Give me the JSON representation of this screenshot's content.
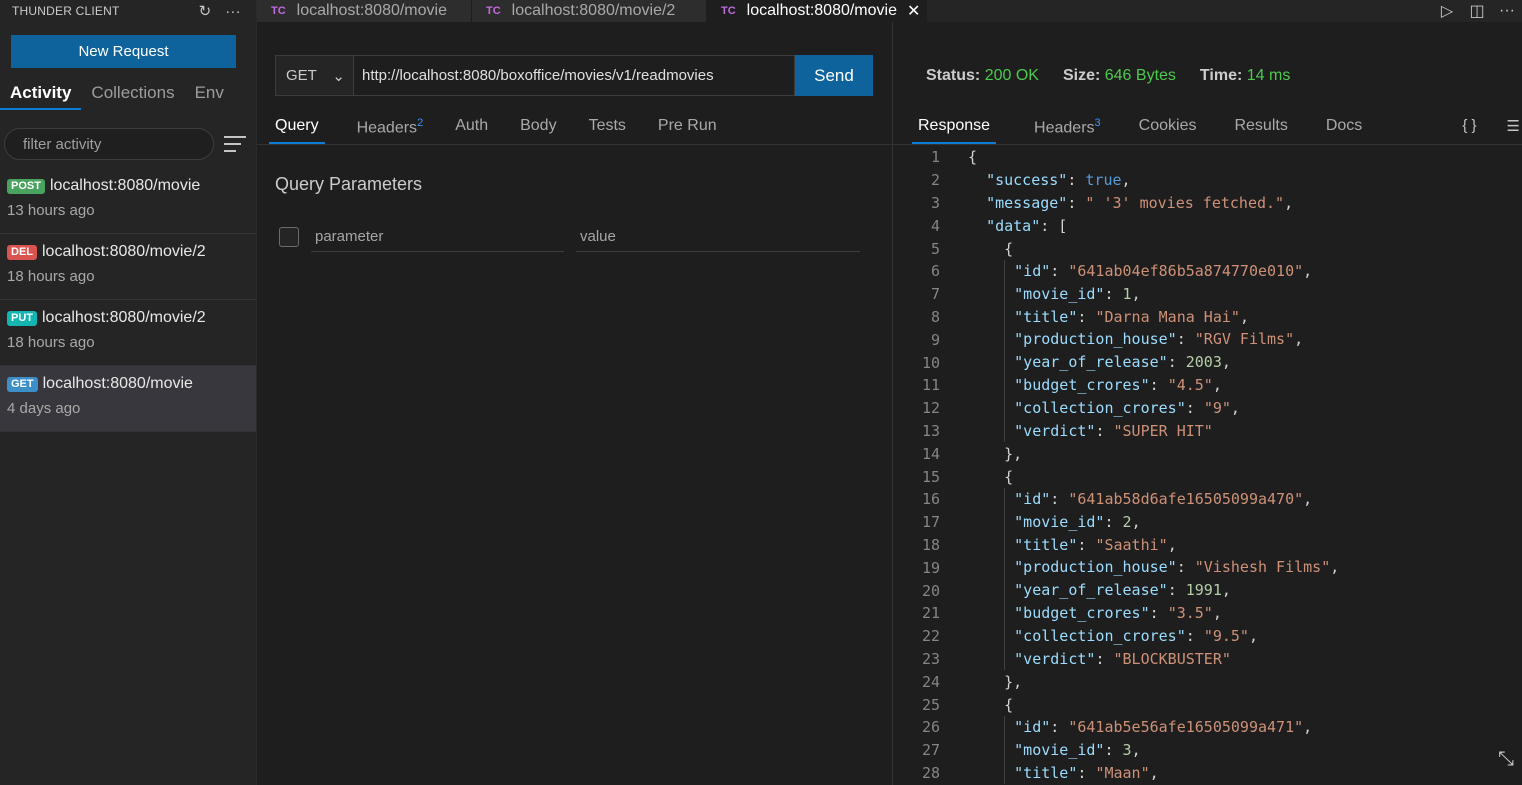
{
  "sidebar": {
    "title": "THUNDER CLIENT",
    "new_request_label": "New Request",
    "tabs": [
      {
        "label": "Activity"
      },
      {
        "label": "Collections"
      },
      {
        "label": "Env"
      }
    ],
    "filter_placeholder": "filter activity",
    "activity": [
      {
        "method": "POST",
        "url": "localhost:8080/movie",
        "time": "13 hours ago"
      },
      {
        "method": "DEL",
        "url": "localhost:8080/movie/2",
        "time": "18 hours ago"
      },
      {
        "method": "PUT",
        "url": "localhost:8080/movie/2",
        "time": "18 hours ago"
      },
      {
        "method": "GET",
        "url": "localhost:8080/movie",
        "time": "4 days ago"
      }
    ]
  },
  "tabs": [
    {
      "badge": "TC",
      "label": "localhost:8080/movie"
    },
    {
      "badge": "TC",
      "label": "localhost:8080/movie/2"
    },
    {
      "badge": "TC",
      "label": "localhost:8080/movie"
    }
  ],
  "request": {
    "method": "GET",
    "url": "http://localhost:8080/boxoffice/movies/v1/readmovies",
    "send_label": "Send",
    "tabs": [
      {
        "label": "Query",
        "count": ""
      },
      {
        "label": "Headers",
        "count": "2"
      },
      {
        "label": "Auth",
        "count": ""
      },
      {
        "label": "Body",
        "count": ""
      },
      {
        "label": "Tests",
        "count": ""
      },
      {
        "label": "Pre Run",
        "count": ""
      }
    ],
    "query_title": "Query Parameters",
    "param_placeholder": "parameter",
    "value_placeholder": "value"
  },
  "response": {
    "status_label": "Status:",
    "status_value": "200 OK",
    "size_label": "Size:",
    "size_value": "646 Bytes",
    "time_label": "Time:",
    "time_value": "14 ms",
    "tabs": [
      {
        "label": "Response",
        "count": ""
      },
      {
        "label": "Headers",
        "count": "3"
      },
      {
        "label": "Cookies",
        "count": ""
      },
      {
        "label": "Results",
        "count": ""
      },
      {
        "label": "Docs",
        "count": ""
      }
    ],
    "braces_label": "{ }",
    "lines": [
      {
        "n": "1",
        "indent": 0,
        "parts": [
          [
            "p",
            "{"
          ]
        ]
      },
      {
        "n": "2",
        "indent": 1,
        "parts": [
          [
            "k",
            "\"success\""
          ],
          [
            "p",
            ": "
          ],
          [
            "b",
            "true"
          ],
          [
            "p",
            ","
          ]
        ]
      },
      {
        "n": "3",
        "indent": 1,
        "parts": [
          [
            "k",
            "\"message\""
          ],
          [
            "p",
            ": "
          ],
          [
            "s",
            "\" '3' movies fetched.\""
          ],
          [
            "p",
            ","
          ]
        ]
      },
      {
        "n": "4",
        "indent": 1,
        "parts": [
          [
            "k",
            "\"data\""
          ],
          [
            "p",
            ": ["
          ]
        ]
      },
      {
        "n": "5",
        "indent": 2,
        "parts": [
          [
            "p",
            "{"
          ]
        ]
      },
      {
        "n": "6",
        "indent": 3,
        "parts": [
          [
            "k",
            "\"id\""
          ],
          [
            "p",
            ": "
          ],
          [
            "s",
            "\"641ab04ef86b5a874770e010\""
          ],
          [
            "p",
            ","
          ]
        ]
      },
      {
        "n": "7",
        "indent": 3,
        "parts": [
          [
            "k",
            "\"movie_id\""
          ],
          [
            "p",
            ": "
          ],
          [
            "n",
            "1"
          ],
          [
            "p",
            ","
          ]
        ]
      },
      {
        "n": "8",
        "indent": 3,
        "parts": [
          [
            "k",
            "\"title\""
          ],
          [
            "p",
            ": "
          ],
          [
            "s",
            "\"Darna Mana Hai\""
          ],
          [
            "p",
            ","
          ]
        ]
      },
      {
        "n": "9",
        "indent": 3,
        "parts": [
          [
            "k",
            "\"production_house\""
          ],
          [
            "p",
            ": "
          ],
          [
            "s",
            "\"RGV Films\""
          ],
          [
            "p",
            ","
          ]
        ]
      },
      {
        "n": "10",
        "indent": 3,
        "parts": [
          [
            "k",
            "\"year_of_release\""
          ],
          [
            "p",
            ": "
          ],
          [
            "n",
            "2003"
          ],
          [
            "p",
            ","
          ]
        ]
      },
      {
        "n": "11",
        "indent": 3,
        "parts": [
          [
            "k",
            "\"budget_crores\""
          ],
          [
            "p",
            ": "
          ],
          [
            "s",
            "\"4.5\""
          ],
          [
            "p",
            ","
          ]
        ]
      },
      {
        "n": "12",
        "indent": 3,
        "parts": [
          [
            "k",
            "\"collection_crores\""
          ],
          [
            "p",
            ": "
          ],
          [
            "s",
            "\"9\""
          ],
          [
            "p",
            ","
          ]
        ]
      },
      {
        "n": "13",
        "indent": 3,
        "parts": [
          [
            "k",
            "\"verdict\""
          ],
          [
            "p",
            ": "
          ],
          [
            "s",
            "\"SUPER HIT\""
          ]
        ]
      },
      {
        "n": "14",
        "indent": 2,
        "parts": [
          [
            "p",
            "},"
          ]
        ]
      },
      {
        "n": "15",
        "indent": 2,
        "parts": [
          [
            "p",
            "{"
          ]
        ]
      },
      {
        "n": "16",
        "indent": 3,
        "parts": [
          [
            "k",
            "\"id\""
          ],
          [
            "p",
            ": "
          ],
          [
            "s",
            "\"641ab58d6afe16505099a470\""
          ],
          [
            "p",
            ","
          ]
        ]
      },
      {
        "n": "17",
        "indent": 3,
        "parts": [
          [
            "k",
            "\"movie_id\""
          ],
          [
            "p",
            ": "
          ],
          [
            "n",
            "2"
          ],
          [
            "p",
            ","
          ]
        ]
      },
      {
        "n": "18",
        "indent": 3,
        "parts": [
          [
            "k",
            "\"title\""
          ],
          [
            "p",
            ": "
          ],
          [
            "s",
            "\"Saathi\""
          ],
          [
            "p",
            ","
          ]
        ]
      },
      {
        "n": "19",
        "indent": 3,
        "parts": [
          [
            "k",
            "\"production_house\""
          ],
          [
            "p",
            ": "
          ],
          [
            "s",
            "\"Vishesh Films\""
          ],
          [
            "p",
            ","
          ]
        ]
      },
      {
        "n": "20",
        "indent": 3,
        "parts": [
          [
            "k",
            "\"year_of_release\""
          ],
          [
            "p",
            ": "
          ],
          [
            "n",
            "1991"
          ],
          [
            "p",
            ","
          ]
        ]
      },
      {
        "n": "21",
        "indent": 3,
        "parts": [
          [
            "k",
            "\"budget_crores\""
          ],
          [
            "p",
            ": "
          ],
          [
            "s",
            "\"3.5\""
          ],
          [
            "p",
            ","
          ]
        ]
      },
      {
        "n": "22",
        "indent": 3,
        "parts": [
          [
            "k",
            "\"collection_crores\""
          ],
          [
            "p",
            ": "
          ],
          [
            "s",
            "\"9.5\""
          ],
          [
            "p",
            ","
          ]
        ]
      },
      {
        "n": "23",
        "indent": 3,
        "parts": [
          [
            "k",
            "\"verdict\""
          ],
          [
            "p",
            ": "
          ],
          [
            "s",
            "\"BLOCKBUSTER\""
          ]
        ]
      },
      {
        "n": "24",
        "indent": 2,
        "parts": [
          [
            "p",
            "},"
          ]
        ]
      },
      {
        "n": "25",
        "indent": 2,
        "parts": [
          [
            "p",
            "{"
          ]
        ]
      },
      {
        "n": "26",
        "indent": 3,
        "parts": [
          [
            "k",
            "\"id\""
          ],
          [
            "p",
            ": "
          ],
          [
            "s",
            "\"641ab5e56afe16505099a471\""
          ],
          [
            "p",
            ","
          ]
        ]
      },
      {
        "n": "27",
        "indent": 3,
        "parts": [
          [
            "k",
            "\"movie_id\""
          ],
          [
            "p",
            ": "
          ],
          [
            "n",
            "3"
          ],
          [
            "p",
            ","
          ]
        ]
      },
      {
        "n": "28",
        "indent": 3,
        "parts": [
          [
            "k",
            "\"title\""
          ],
          [
            "p",
            ": "
          ],
          [
            "s",
            "\"Maan\""
          ],
          [
            "p",
            ","
          ]
        ]
      }
    ]
  },
  "colors": {
    "accent": "#0e639c",
    "status_ok": "#4ec94e",
    "tc_badge": "#c16be0"
  },
  "icons": [
    "refresh-icon",
    "more-icon",
    "close-icon",
    "run-icon",
    "split-editor-icon",
    "menu-icon",
    "chevron-down-icon",
    "expand-icon"
  ]
}
